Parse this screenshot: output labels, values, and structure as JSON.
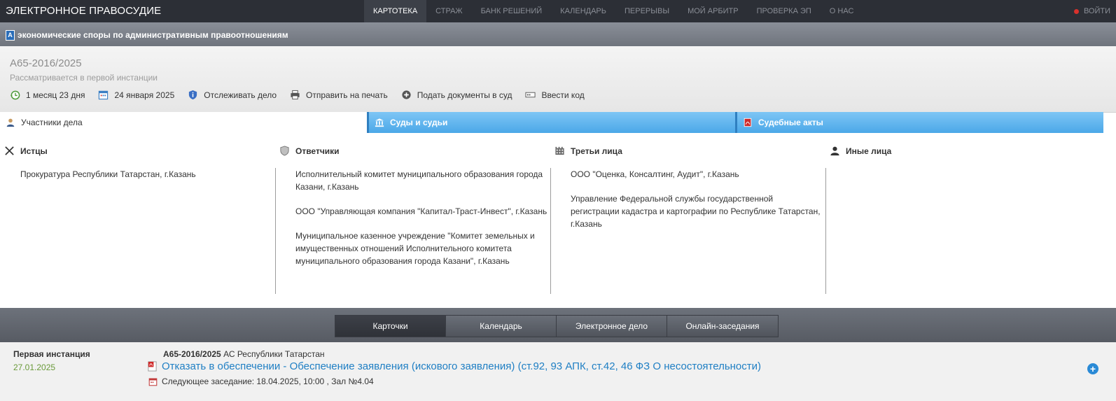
{
  "topbar": {
    "brand": "ЭЛЕКТРОННОЕ ПРАВОСУДИЕ",
    "nav": [
      "КАРТОТЕКА",
      "СТРАЖ",
      "БАНК РЕШЕНИЙ",
      "КАЛЕНДАРЬ",
      "ПЕРЕРЫВЫ",
      "МОЙ АРБИТР",
      "ПРОВЕРКА ЭП",
      "О НАС"
    ],
    "login": "ВОЙТИ"
  },
  "category": {
    "icon": "A",
    "title": "экономические споры по административным правоотношениям"
  },
  "case": {
    "number": "А65-2016/2025",
    "status": "Рассматривается в первой инстанции",
    "actions": {
      "duration": "1 месяц 23 дня",
      "date": "24 января 2025",
      "track": "Отслеживать дело",
      "print": "Отправить на печать",
      "submit": "Подать документы в суд",
      "code": "Ввести код"
    }
  },
  "tabs": [
    "Участники дела",
    "Суды и судьи",
    "Судебные акты"
  ],
  "participants": {
    "plaintiffs": {
      "title": "Истцы",
      "items": [
        "Прокуратура Республики Татарстан, г.Казань"
      ]
    },
    "defendants": {
      "title": "Ответчики",
      "items": [
        "Исполнительный комитет муниципального образования города Казани, г.Казань",
        "ООО \"Управляющая компания \"Капитал-Траст-Инвест\", г.Казань",
        "Муниципальное казенное учреждение \"Комитет земельных и имущественных отношений Исполнительного комитета муниципального образования города Казани\", г.Казань"
      ]
    },
    "third": {
      "title": "Третьи лица",
      "items": [
        "ООО \"Оценка, Консалтинг, Аудит\", г.Казань",
        "Управление Федеральной службы государственной регистрации кадастра и картографии по Республике Татарстан, г.Казань"
      ]
    },
    "other": {
      "title": "Иные лица",
      "items": []
    }
  },
  "bottom_tabs": [
    "Карточки",
    "Календарь",
    "Электронное дело",
    "Онлайн-заседания"
  ],
  "card": {
    "instance": "Первая инстанция",
    "date": "27.01.2025",
    "case_number": "А65-2016/2025",
    "court": "АС Республики Татарстан",
    "document": "Отказать в обеспечении - Обеспечение заявления (искового заявления) (ст.92, 93 АПК, ст.42, 46 ФЗ О несостоятельности)",
    "next_hearing": "Следующее заседание: 18.04.2025, 10:00 , Зал №4.04"
  }
}
